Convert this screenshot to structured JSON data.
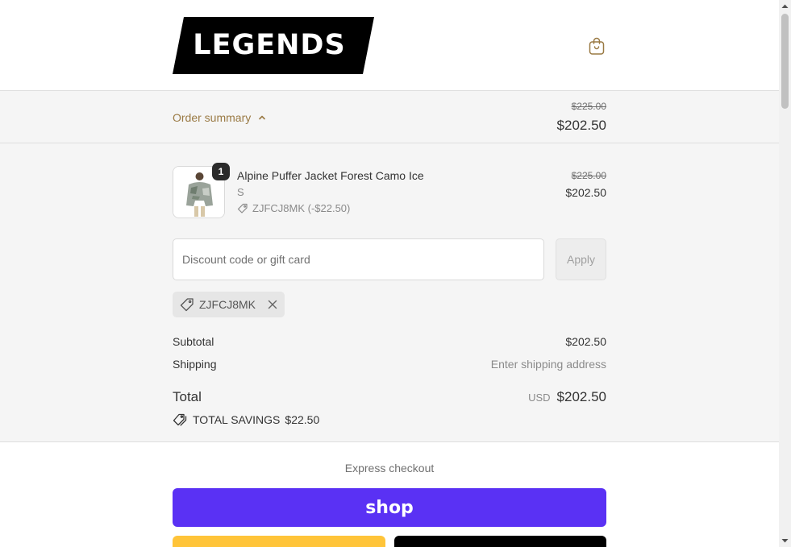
{
  "brand": {
    "logo_text": "LEGENDS"
  },
  "icons": {
    "cart": "shopping-bag-icon",
    "toggle": "chevron-up-icon",
    "discount_tag": "tag-icon",
    "remove": "close-icon",
    "savings": "tags-icon"
  },
  "summary": {
    "toggle_label": "Order summary",
    "original_total": "$225.00",
    "total": "$202.50"
  },
  "product": {
    "quantity": "1",
    "title": "Alpine Puffer Jacket Forest Camo Ice",
    "variant": "S",
    "discount_line": "ZJFCJ8MK (-$22.50)",
    "original_price": "$225.00",
    "price": "$202.50"
  },
  "discount": {
    "placeholder": "Discount code or gift card",
    "apply_label": "Apply",
    "applied_code": "ZJFCJ8MK"
  },
  "totals": {
    "subtotal_label": "Subtotal",
    "subtotal_value": "$202.50",
    "shipping_label": "Shipping",
    "shipping_value": "Enter shipping address",
    "total_label": "Total",
    "currency": "USD",
    "total_value": "$202.50",
    "savings_label": "TOTAL SAVINGS",
    "savings_value": "$22.50"
  },
  "express": {
    "label": "Express checkout",
    "shop_pay_label": "shop"
  },
  "colors": {
    "accent": "#9a7a44",
    "shop_pay": "#5a31f4",
    "paypal": "#ffc439",
    "gpay": "#000000",
    "summary_bg": "#f5f5f5"
  }
}
